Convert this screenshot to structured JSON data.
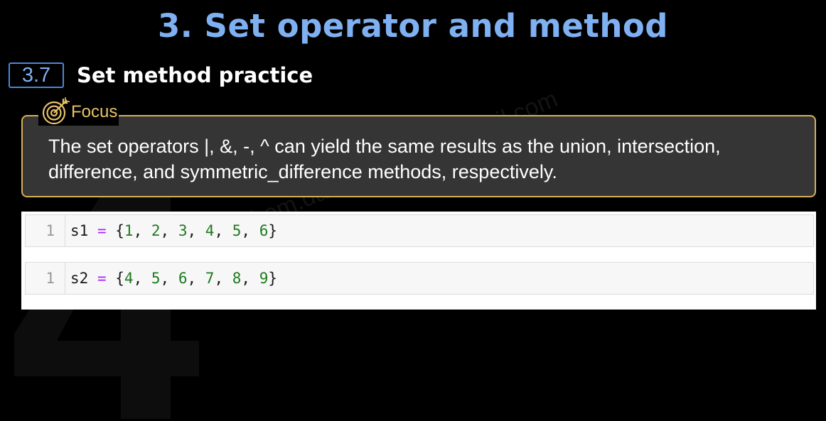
{
  "slide": {
    "title": "3. Set operator and method",
    "section_number": "3.7",
    "section_title": "Set method practice",
    "colors": {
      "title": "#7fb0f2",
      "focus_border": "#d6b05a",
      "focus_bg": "#353535",
      "operator": "#aa22ff",
      "number": "#1f7a1f"
    }
  },
  "focus": {
    "icon": "target-icon",
    "label": "Focus",
    "text": "The set operators |, &, -, ^ can yield the same results as the union, intersection, difference, and symmetric_difference methods, respectively."
  },
  "code_cells": [
    {
      "line_number": "1",
      "var": "s1",
      "op": "=",
      "values": [
        "1",
        "2",
        "3",
        "4",
        "5",
        "6"
      ]
    },
    {
      "line_number": "1",
      "var": "s2",
      "op": "=",
      "values": [
        "4",
        "5",
        "6",
        "7",
        "8",
        "9"
      ]
    }
  ],
  "watermark": {
    "text": "phem.dararaksmey@gmail.com"
  }
}
